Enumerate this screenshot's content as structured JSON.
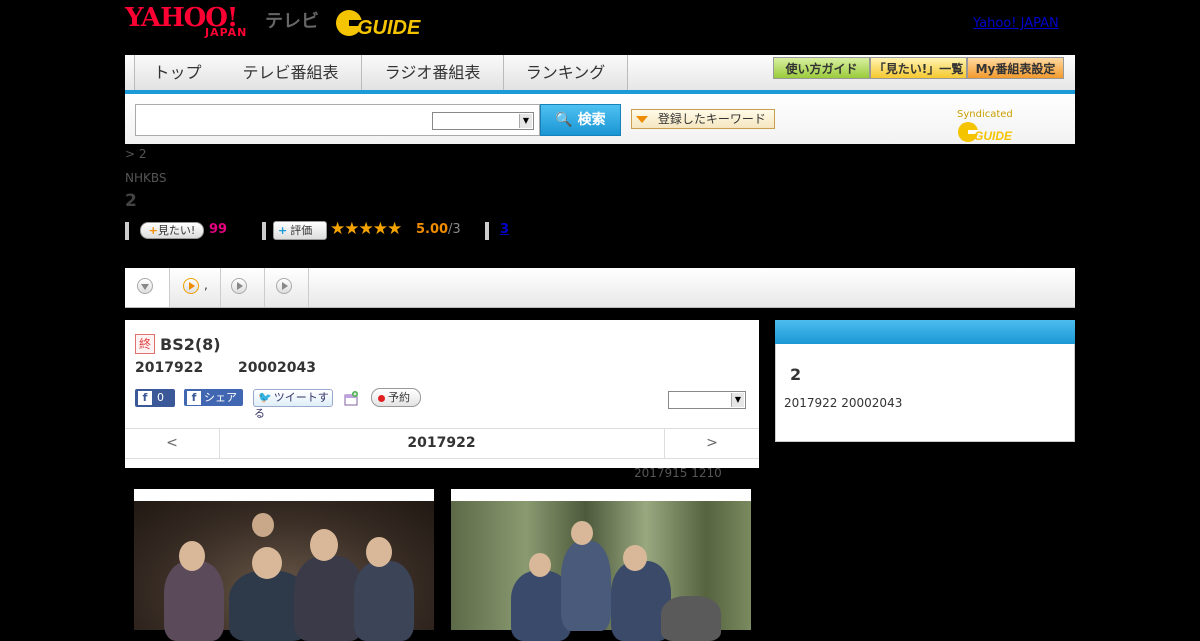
{
  "header": {
    "brand": "YAHOO!",
    "brand_sub": "JAPAN",
    "brand_tv": "テレビ",
    "gguide": "GUIDE",
    "top_link": "Yahoo! JAPAN"
  },
  "nav": {
    "tabs": [
      {
        "label": "トップ"
      },
      {
        "label": "テレビ番組表"
      },
      {
        "label": "ラジオ番組表"
      },
      {
        "label": "ランキング"
      }
    ],
    "buttons": [
      {
        "label": "使い方ガイド"
      },
      {
        "label": "「見たい!」一覧"
      },
      {
        "label": "My番組表設定"
      }
    ]
  },
  "search": {
    "value": "",
    "button_label": "検索",
    "keyword_label": "登録したキーワード",
    "syndicated": "Syndicated"
  },
  "program": {
    "breadcrumb": "> 2",
    "station": "NHKBS",
    "title": "2",
    "mitai_label": "見たい!",
    "mitai_count": "99",
    "hyoka_label": "評価",
    "stars": "★★★★★",
    "score": "5.00",
    "score_max": "/3",
    "review_count": "3",
    "rating": 5.0
  },
  "tabs_row": {
    "second_label": ","
  },
  "main": {
    "end_badge": "終",
    "channel": "BS2(8)",
    "date": "2017922",
    "time": "20002043",
    "fb_like_count": "0",
    "fb_share_label": "シェア",
    "tweet_label": "ツイートする",
    "yoyaku_label": "予約",
    "date_nav": {
      "prev": "<",
      "date": "2017922",
      "next": ">"
    },
    "updated": "2017915  1210"
  },
  "side": {
    "title": "2",
    "date": "2017922  20002043"
  },
  "colors": {
    "accent": "#1a9bd7",
    "brand_red": "#ff0033",
    "star": "#f5a300",
    "mitai_pink": "#e4007f"
  }
}
